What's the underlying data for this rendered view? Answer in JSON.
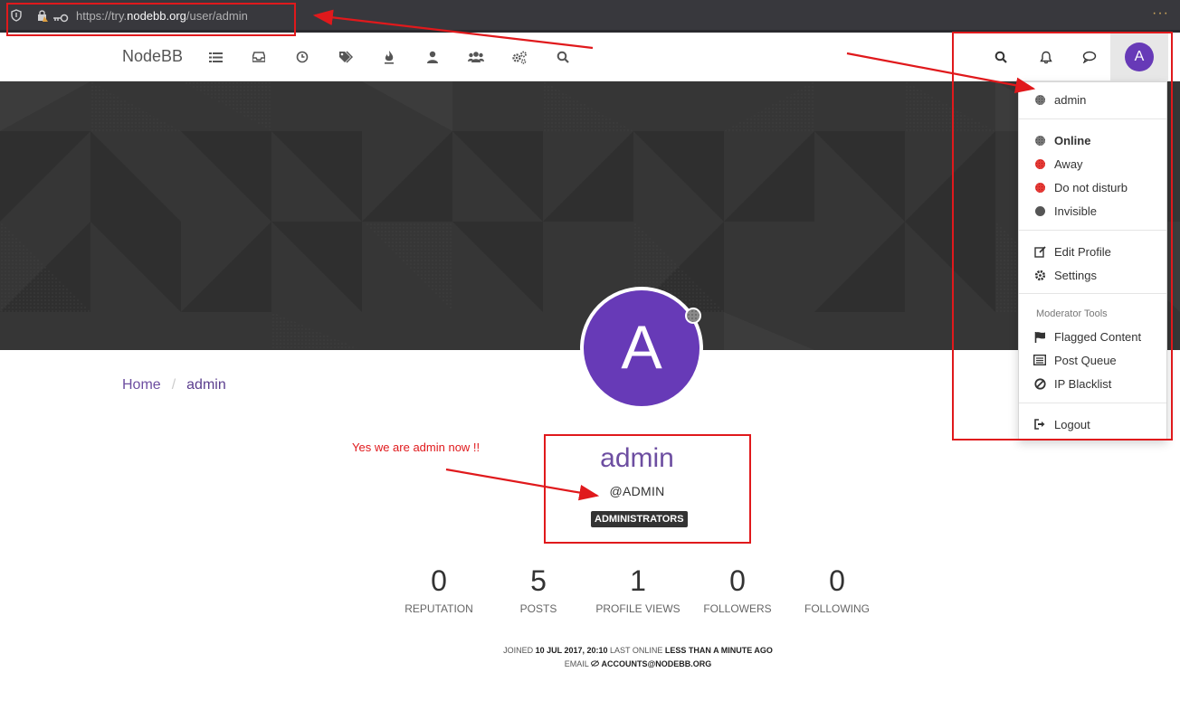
{
  "browser": {
    "url_scheme": "https://try.",
    "url_host": "nodebb.org",
    "url_path": "/user/admin",
    "more_label": "···"
  },
  "navbar": {
    "brand": "NodeBB",
    "icons": [
      "categories-icon",
      "unread-icon",
      "recent-icon",
      "tags-icon",
      "popular-icon",
      "users-icon",
      "groups-icon",
      "admin-icon",
      "search-icon"
    ],
    "right_icons": [
      "search-icon",
      "notifications-icon",
      "chat-icon"
    ],
    "avatar_letter": "A"
  },
  "profile": {
    "avatar_letter": "A",
    "fullname": "admin",
    "username": "@ADMIN",
    "group_badge": "ADMINISTRATORS",
    "stats": [
      {
        "value": "0",
        "label": "REPUTATION"
      },
      {
        "value": "5",
        "label": "POSTS"
      },
      {
        "value": "1",
        "label": "PROFILE VIEWS"
      },
      {
        "value": "0",
        "label": "FOLLOWERS"
      },
      {
        "value": "0",
        "label": "FOLLOWING"
      }
    ],
    "joined_label": "JOINED",
    "joined_value": "10 JUL 2017, 20:10",
    "last_online_label": "LAST ONLINE",
    "last_online_value": "LESS THAN A MINUTE AGO",
    "email_label": "EMAIL",
    "email_value": "ACCOUNTS@NODEBB.ORG"
  },
  "breadcrumb": {
    "home": "Home",
    "separator": "/",
    "current": "admin"
  },
  "dropdown": {
    "user": "admin",
    "statuses": [
      {
        "label": "Online",
        "active": true,
        "color": "#777777"
      },
      {
        "label": "Away",
        "active": false,
        "color": "#e53935"
      },
      {
        "label": "Do not disturb",
        "active": false,
        "color": "#e53935"
      },
      {
        "label": "Invisible",
        "active": false,
        "color": "#555555"
      }
    ],
    "edit_profile": "Edit Profile",
    "settings": "Settings",
    "moderator_header": "Moderator Tools",
    "flagged_content": "Flagged Content",
    "post_queue": "Post Queue",
    "ip_blacklist": "IP Blacklist",
    "logout": "Logout"
  },
  "annotation": {
    "note": "Yes we are admin now !!",
    "color": "#e0191c"
  },
  "colors": {
    "brand_purple": "#673ab7",
    "link_purple": "#6d4ea1",
    "cover": "#363636"
  }
}
